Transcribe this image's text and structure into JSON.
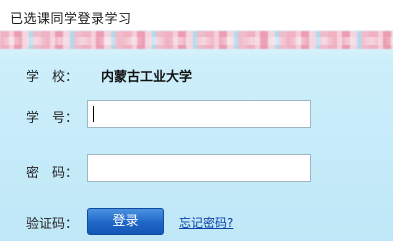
{
  "header": {
    "title": "已选课同学登录学习"
  },
  "form": {
    "school_label": "学　校：",
    "school_value": "内蒙古工业大学",
    "student_id_label": "学　号：",
    "student_id_value": "",
    "password_label": "密　码：",
    "password_value": "",
    "captcha_label": "验证码：",
    "login_button": "登录",
    "forgot_password_link": "忘记密码?"
  },
  "colors": {
    "background": "#c8ecf9",
    "button": "#1e66c8",
    "link": "#0b3fa8"
  }
}
